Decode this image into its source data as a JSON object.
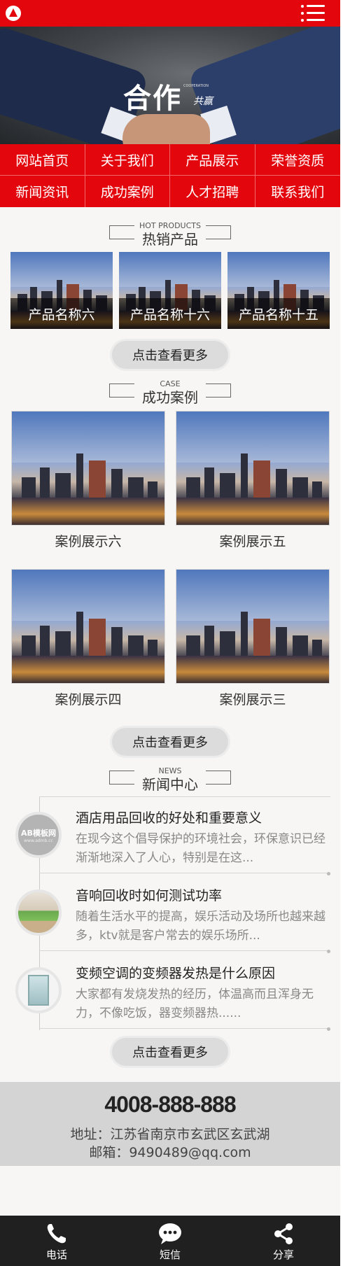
{
  "header": {
    "logo_icon": "logo-icon",
    "menu_icon": "menu-icon"
  },
  "banner": {
    "title": "合作",
    "subtitle": "共赢",
    "tiny": "COOPERATION"
  },
  "nav": {
    "items": [
      {
        "label": "网站首页"
      },
      {
        "label": "关于我们"
      },
      {
        "label": "产品展示"
      },
      {
        "label": "荣誉资质"
      },
      {
        "label": "新闻资讯"
      },
      {
        "label": "成功案例"
      },
      {
        "label": "人才招聘"
      },
      {
        "label": "联系我们"
      }
    ]
  },
  "products": {
    "title_en": "HOT PRODUCTS",
    "title": "热销产品",
    "items": [
      {
        "name": "产品名称六"
      },
      {
        "name": "产品名称十六"
      },
      {
        "name": "产品名称十五"
      }
    ],
    "more": "点击查看更多"
  },
  "cases": {
    "title_en": "CASE",
    "title": "成功案例",
    "items": [
      {
        "name": "案例展示六"
      },
      {
        "name": "案例展示五"
      },
      {
        "name": "案例展示四"
      },
      {
        "name": "案例展示三"
      }
    ],
    "more": "点击查看更多"
  },
  "news": {
    "title_en": "NEWS",
    "title": "新闻中心",
    "thumb_text": "AB模板网",
    "thumb_sub": "www.admb.cc",
    "items": [
      {
        "title": "酒店用品回收的好处和重要意义",
        "desc": "在现今这个倡导保护的环境社会，环保意识已经渐渐地深入了人心，特别是在这..."
      },
      {
        "title": "音响回收时如何测试功率",
        "desc": "随着生活水平的提高，娱乐活动及场所也越来越多，ktv就是客户常去的娱乐场所..."
      },
      {
        "title": "变频空调的变频器发热是什么原因",
        "desc": "大家都有发烧发热的经历，体温高而且浑身无力，不像吃饭，器变频器热......"
      }
    ],
    "more": "点击查看更多"
  },
  "contact": {
    "tel": "4008-888-888",
    "address": "地址：江苏省南京市玄武区玄武湖",
    "email": "邮箱：9490489@qq.com"
  },
  "bottombar": {
    "items": [
      {
        "label": "电话",
        "icon": "phone-icon"
      },
      {
        "label": "短信",
        "icon": "message-icon"
      },
      {
        "label": "分享",
        "icon": "share-icon"
      }
    ]
  },
  "colors": {
    "brand": "#e3060c",
    "footer_bar": "#202020",
    "info_bg": "#d4d4d4"
  }
}
